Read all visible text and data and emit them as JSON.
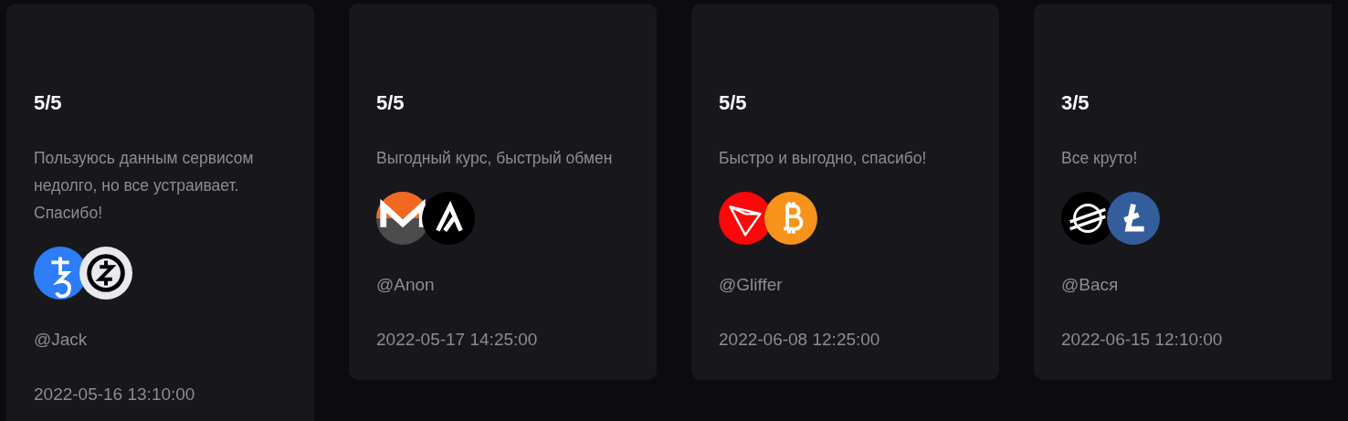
{
  "reviews": [
    {
      "rating": "5/5",
      "text": "Пользуюсь данным сервисом недолго, но все устраивает. Спасибо!",
      "coins": [
        {
          "kind": "tezos"
        },
        {
          "kind": "zcash"
        }
      ],
      "user": "@Jack",
      "date": "2022-05-16 13:10:00"
    },
    {
      "rating": "5/5",
      "text": "Выгодный курс, быстрый обмен",
      "coins": [
        {
          "kind": "monero"
        },
        {
          "kind": "algorand"
        }
      ],
      "user": "@Anon",
      "date": "2022-05-17 14:25:00"
    },
    {
      "rating": "5/5",
      "text": "Быстро и выгодно, спасибо!",
      "coins": [
        {
          "kind": "tron"
        },
        {
          "kind": "bitcoin"
        }
      ],
      "user": "@Gliffer",
      "date": "2022-06-08 12:25:00"
    },
    {
      "rating": "3/5",
      "text": "Все круто!",
      "coins": [
        {
          "kind": "stellar"
        },
        {
          "kind": "litecoin"
        }
      ],
      "user": "@Вася",
      "date": "2022-06-15 12:10:00"
    }
  ]
}
